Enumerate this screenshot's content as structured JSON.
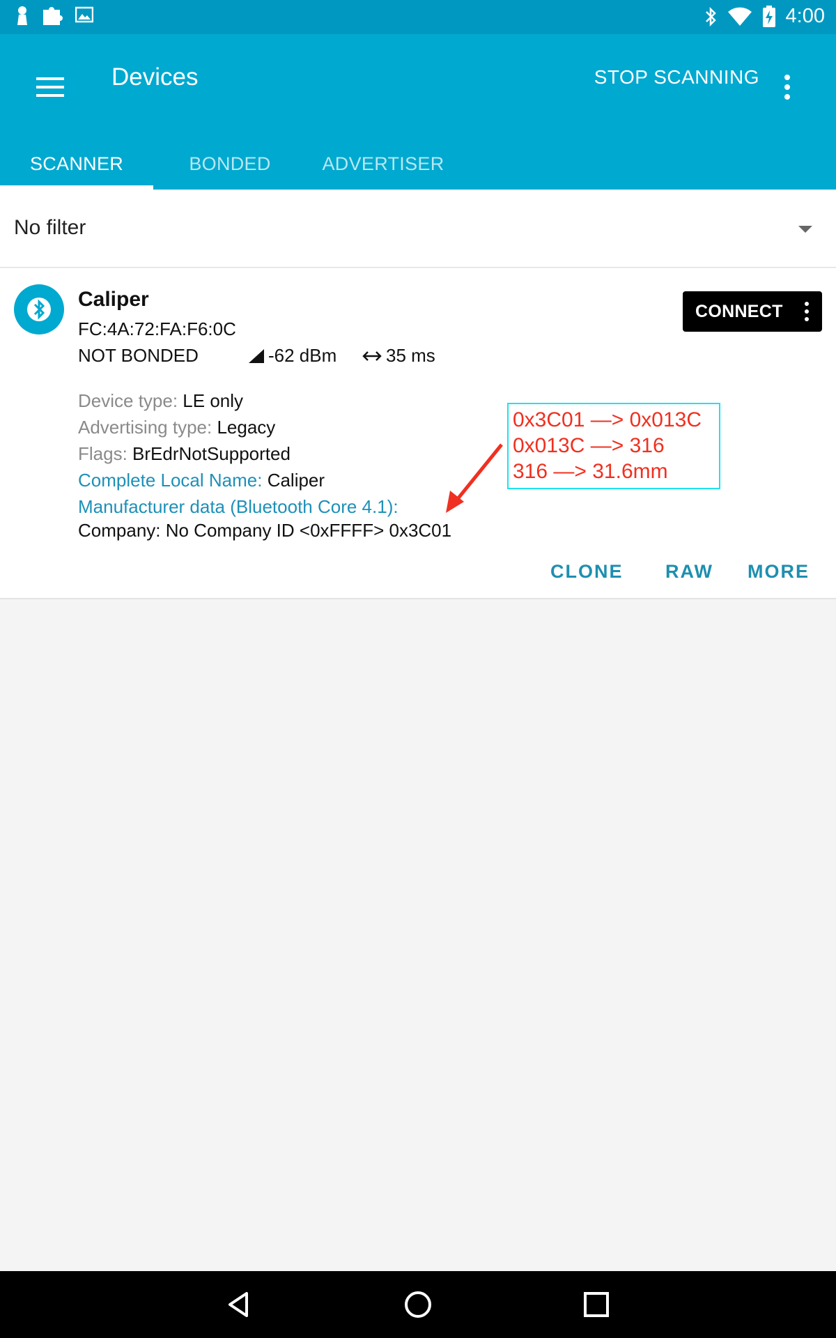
{
  "status_bar": {
    "time": "4:00",
    "left_icons": [
      "pawn-icon",
      "puzzle-icon",
      "image-icon"
    ],
    "right_icons": [
      "bluetooth-icon",
      "wifi-icon",
      "battery-charging-icon"
    ]
  },
  "app_bar": {
    "title": "Devices",
    "stop_scanning_label": "STOP SCANNING",
    "tabs": [
      {
        "label": "SCANNER",
        "active": true
      },
      {
        "label": "BONDED",
        "active": false
      },
      {
        "label": "ADVERTISER",
        "active": false
      }
    ]
  },
  "filter": {
    "label": "No filter"
  },
  "device": {
    "name": "Caliper",
    "address": "FC:4A:72:FA:F6:0C",
    "bond_state": "NOT BONDED",
    "rssi": "-62 dBm",
    "interval": "35 ms",
    "connect_label": "CONNECT",
    "details": [
      {
        "key": "Device type: ",
        "value": "LE only",
        "highlight": false
      },
      {
        "key": "Advertising type: ",
        "value": "Legacy",
        "highlight": false
      },
      {
        "key": "Flags: ",
        "value": "BrEdrNotSupported",
        "highlight": false
      },
      {
        "key": "Complete Local Name: ",
        "value": "Caliper",
        "highlight": true
      },
      {
        "key": "Manufacturer data (Bluetooth Core 4.1):",
        "value": "",
        "highlight": true
      }
    ],
    "manufacturer_value": "Company: No Company ID <0xFFFF> 0x3C01",
    "actions": [
      "CLONE",
      "RAW",
      "MORE"
    ]
  },
  "annotation": {
    "lines": [
      "0x3C01 —> 0x013C",
      "0x013C —> 316",
      "316  —> 31.6mm"
    ],
    "text_color": "#f03020",
    "border_color": "#1fe3ee"
  },
  "colors": {
    "app_bar": "#00a9d0",
    "status_bar": "#0098c1",
    "accent": "#1e8fb0"
  }
}
